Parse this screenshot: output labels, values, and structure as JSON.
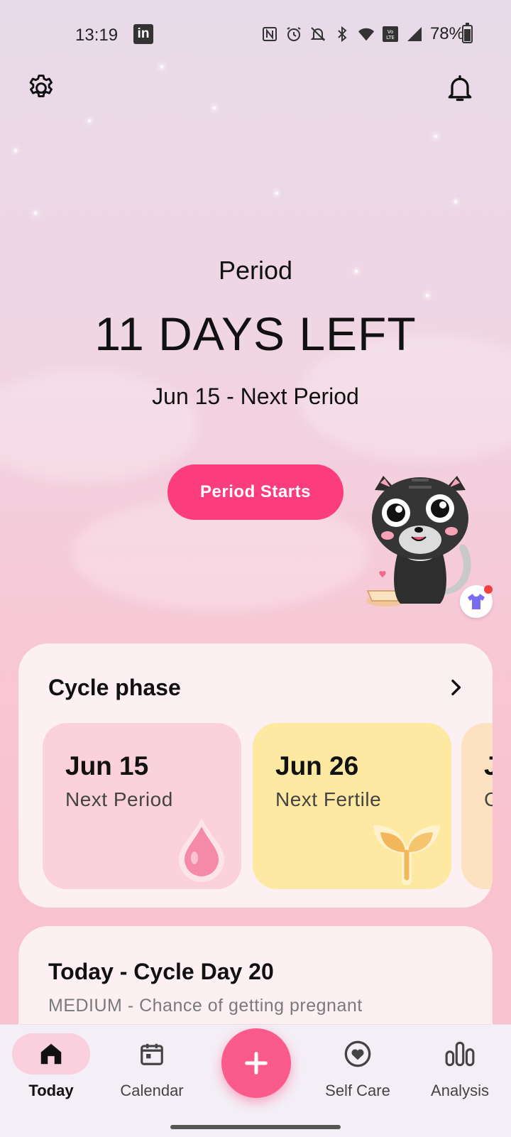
{
  "status_bar": {
    "time": "13:19",
    "app_badge": "in",
    "battery": "78%"
  },
  "hero": {
    "label": "Period",
    "countdown": "11 DAYS LEFT",
    "next_date": "Jun 15 - Next Period",
    "button_label": "Period Starts"
  },
  "cycle_phase": {
    "title": "Cycle phase",
    "phases": [
      {
        "date": "Jun 15",
        "name": "Next Period"
      },
      {
        "date": "Jun 26",
        "name": "Next Fertile"
      },
      {
        "date": "J",
        "name": "C"
      }
    ]
  },
  "today": {
    "title": "Today - Cycle Day 20",
    "subtitle": "MEDIUM - Chance of getting pregnant"
  },
  "nav": {
    "items": [
      {
        "label": "Today"
      },
      {
        "label": "Calendar"
      },
      {
        "label": "Self Care"
      },
      {
        "label": "Analysis"
      }
    ]
  },
  "colors": {
    "accent": "#fb3c7d",
    "period_card": "#fbd1dc",
    "fertile_card": "#fde9a1"
  }
}
